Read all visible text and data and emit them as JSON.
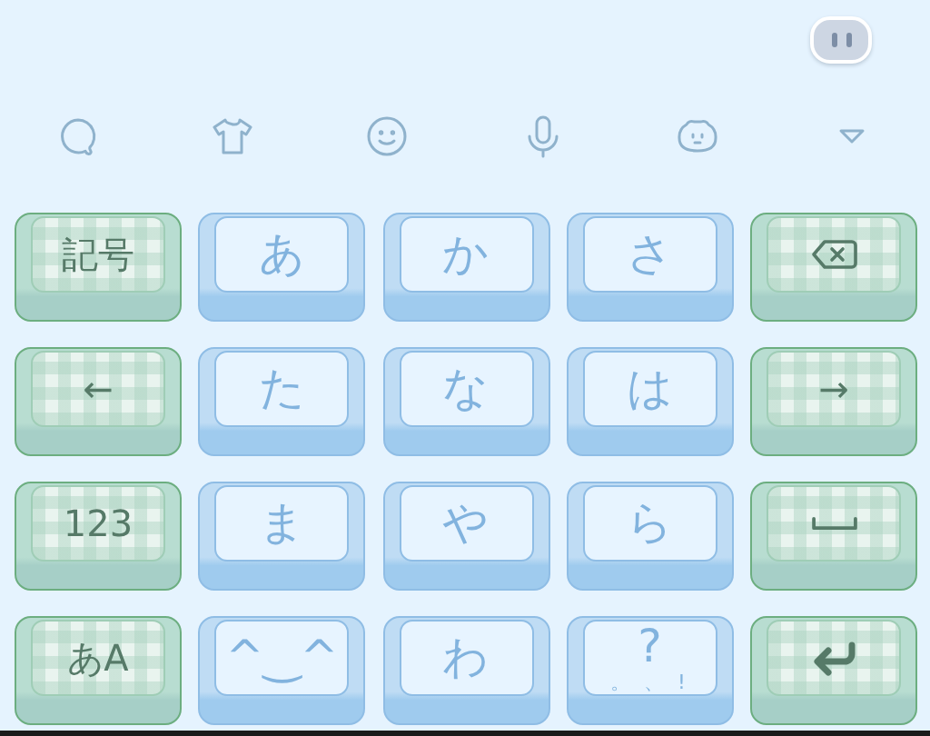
{
  "toolbar": [
    {
      "kind": "chat"
    },
    {
      "kind": "shirt"
    },
    {
      "kind": "smiley"
    },
    {
      "kind": "mic"
    },
    {
      "kind": "bear"
    },
    {
      "kind": "collapse"
    }
  ],
  "keys": [
    {
      "kind": "function",
      "label": "記号"
    },
    {
      "kind": "char",
      "label": "あ"
    },
    {
      "kind": "char",
      "label": "か"
    },
    {
      "kind": "char",
      "label": "さ"
    },
    {
      "kind": "backspace"
    },
    {
      "kind": "function",
      "label": "←"
    },
    {
      "kind": "char",
      "label": "た"
    },
    {
      "kind": "char",
      "label": "な"
    },
    {
      "kind": "char",
      "label": "は"
    },
    {
      "kind": "function",
      "label": "→"
    },
    {
      "kind": "function",
      "label": "123"
    },
    {
      "kind": "char",
      "label": "ま"
    },
    {
      "kind": "char",
      "label": "や"
    },
    {
      "kind": "char",
      "label": "ら"
    },
    {
      "kind": "space"
    },
    {
      "kind": "function",
      "label": "あA"
    },
    {
      "kind": "char",
      "label": "^‿^"
    },
    {
      "kind": "char",
      "label": "わ"
    },
    {
      "kind": "char",
      "label": "?",
      "sub": "。 、 !"
    },
    {
      "kind": "enter"
    }
  ]
}
